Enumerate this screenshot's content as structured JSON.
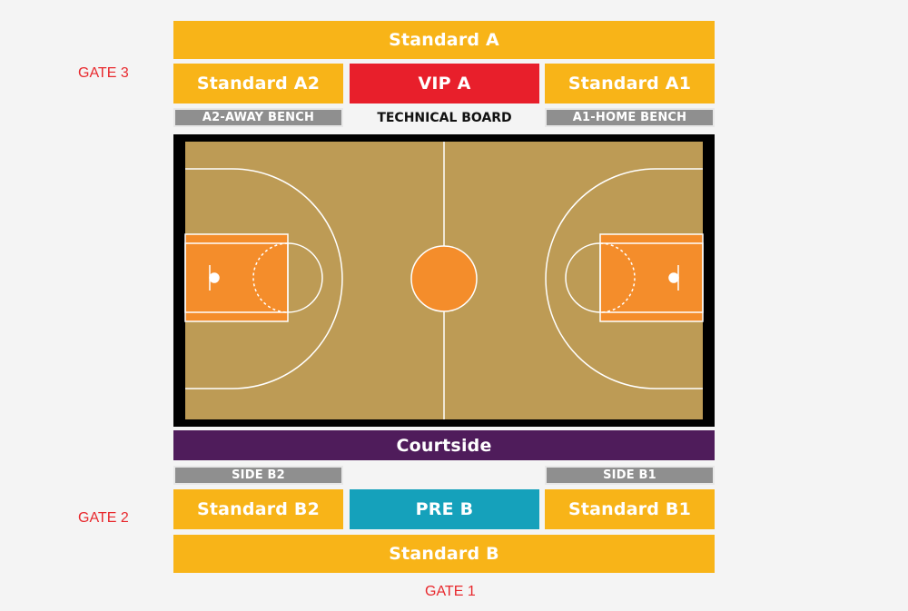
{
  "gates": {
    "gate3": "GATE 3",
    "gate2": "GATE 2",
    "gate1": "GATE 1"
  },
  "sections": {
    "standard_a": "Standard  A",
    "standard_a2": "Standard  A2",
    "vip_a": "VIP A",
    "standard_a1": "Standard A1",
    "a2_away_bench": "A2-AWAY BENCH",
    "technical_board": "TECHNICAL BOARD",
    "a1_home_bench": "A1-HOME BENCH",
    "courtside": "Courtside",
    "side_b2": "SIDE B2",
    "side_b1": "SIDE B1",
    "standard_b2": "Standard  B2",
    "pre_b": "PRE B",
    "standard_b1": "Standard  B1",
    "standard_b": "Standard  B"
  },
  "colors": {
    "standard": "#f8b418",
    "vip": "#e81f2b",
    "courtside": "#4f1c5b",
    "pre": "#15a1bb",
    "bench": "#8f8f8f",
    "court_floor": "#bd9b55",
    "paint": "#f48d2b",
    "court_border": "#000000",
    "gate_text": "#e8282d"
  }
}
